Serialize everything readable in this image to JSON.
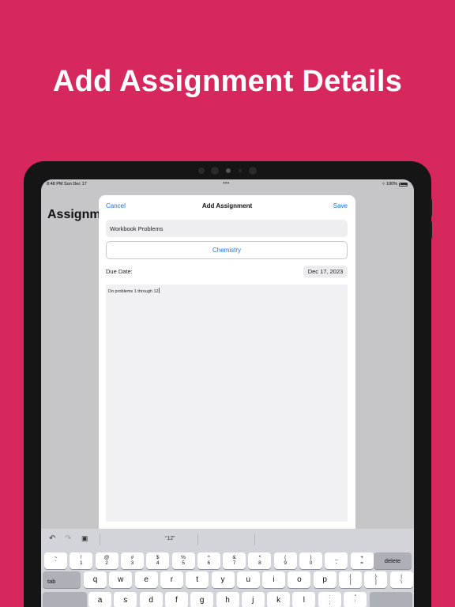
{
  "headline": "Add Assignment Details",
  "status_bar": {
    "time_date": "8:48 PM  Sun Dec 17",
    "battery": "100%"
  },
  "background_title": "Assignme",
  "sheet": {
    "cancel": "Cancel",
    "title": "Add Assignment",
    "save": "Save",
    "name_value": "Workbook Problems",
    "subject": "Chemistry",
    "due_label": "Due Date:",
    "due_value": "Dec 17, 2023",
    "notes": "Do problems 1 through 12"
  },
  "keyboard": {
    "suggestion": "“12”",
    "number_row": [
      {
        "top": "~",
        "bottom": "`"
      },
      {
        "top": "!",
        "bottom": "1"
      },
      {
        "top": "@",
        "bottom": "2"
      },
      {
        "top": "#",
        "bottom": "3"
      },
      {
        "top": "$",
        "bottom": "4"
      },
      {
        "top": "%",
        "bottom": "5"
      },
      {
        "top": "^",
        "bottom": "6"
      },
      {
        "top": "&",
        "bottom": "7"
      },
      {
        "top": "*",
        "bottom": "8"
      },
      {
        "top": "(",
        "bottom": "9"
      },
      {
        "top": ")",
        "bottom": "0"
      },
      {
        "top": "_",
        "bottom": "-"
      },
      {
        "top": "+",
        "bottom": "="
      }
    ],
    "delete": "delete",
    "tab": "tab",
    "letter_row": [
      "q",
      "w",
      "e",
      "r",
      "t",
      "y",
      "u",
      "i",
      "o",
      "p"
    ],
    "bracket_keys": [
      {
        "top": "{",
        "bottom": "["
      },
      {
        "top": "}",
        "bottom": "]"
      },
      {
        "top": "|",
        "bottom": "\\"
      }
    ],
    "third_row": [
      "a",
      "s",
      "d",
      "f",
      "g",
      "h",
      "j",
      "k",
      "l"
    ],
    "third_row_punct": [
      {
        "top": ":",
        "bottom": ";"
      },
      {
        "top": "\"",
        "bottom": "'"
      }
    ]
  }
}
